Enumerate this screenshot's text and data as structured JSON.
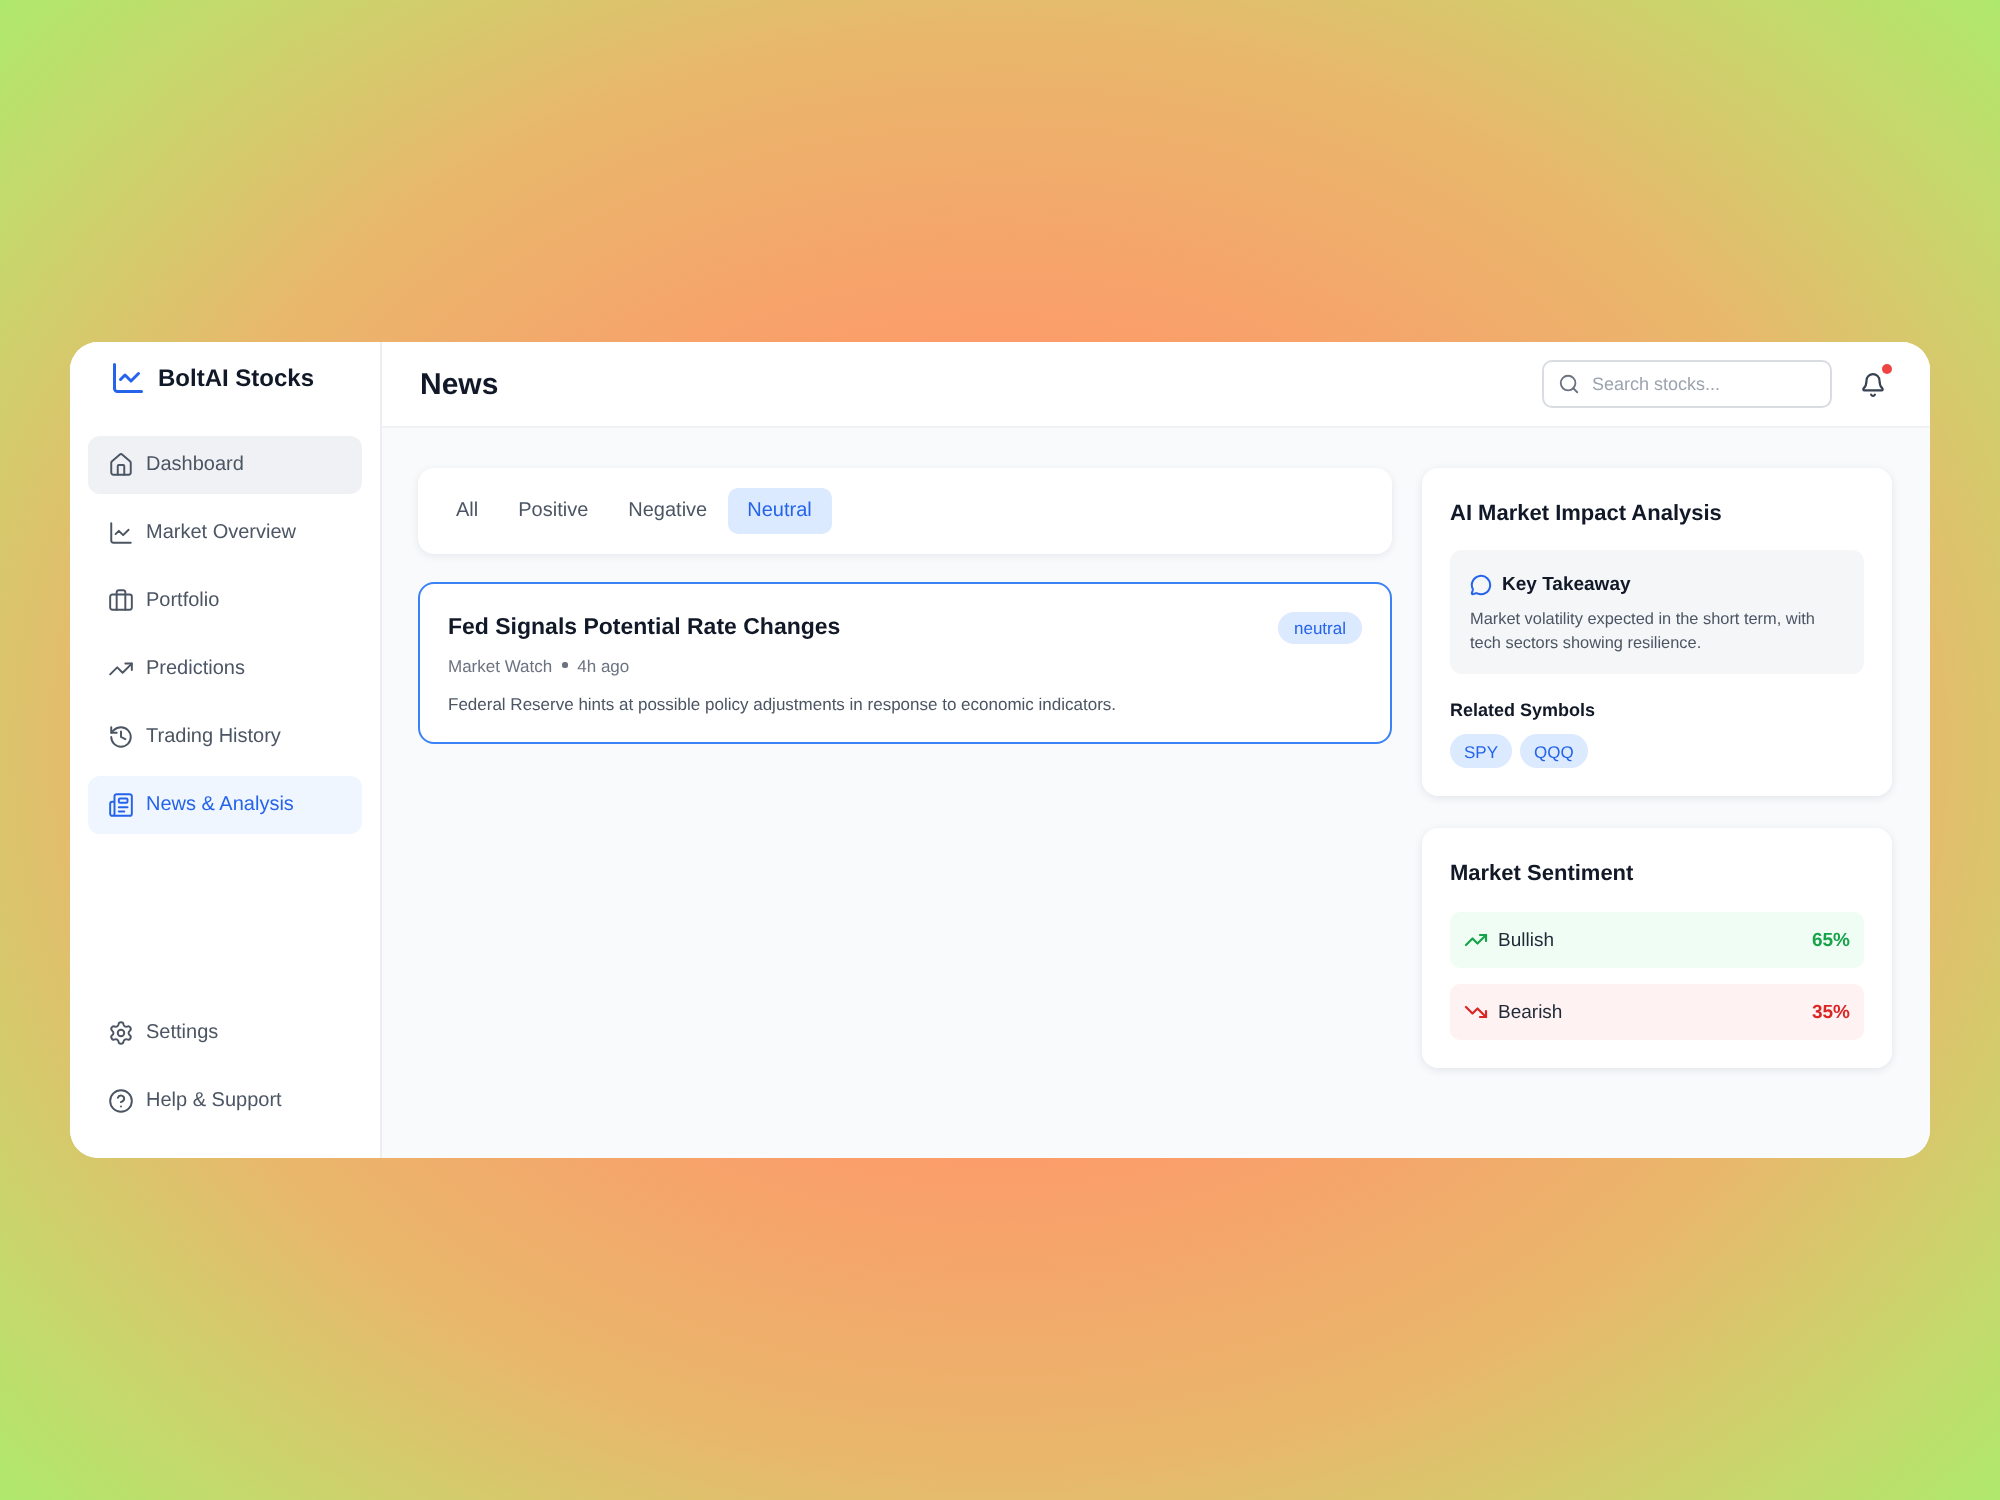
{
  "app": {
    "name": "BoltAI Stocks"
  },
  "sidebar": {
    "items": [
      {
        "label": "Dashboard",
        "selected": false,
        "hovered": true
      },
      {
        "label": "Market Overview",
        "selected": false,
        "hovered": false
      },
      {
        "label": "Portfolio",
        "selected": false,
        "hovered": false
      },
      {
        "label": "Predictions",
        "selected": false,
        "hovered": false
      },
      {
        "label": "Trading History",
        "selected": false,
        "hovered": false
      },
      {
        "label": "News & Analysis",
        "selected": true,
        "hovered": false
      }
    ],
    "footer_items": [
      {
        "label": "Settings",
        "selected": false
      },
      {
        "label": "Help & Support",
        "selected": false
      }
    ]
  },
  "header": {
    "title": "News",
    "search": {
      "placeholder": "Search stocks..."
    },
    "notifications": {
      "unread": true
    }
  },
  "filters": [
    {
      "label": "All",
      "selected": false
    },
    {
      "label": "Positive",
      "selected": false
    },
    {
      "label": "Negative",
      "selected": false
    },
    {
      "label": "Neutral",
      "selected": true
    }
  ],
  "articles": [
    {
      "title": "Fed Signals Potential Rate Changes",
      "source": "Market Watch",
      "time": "4h ago",
      "summary": "Federal Reserve hints at possible policy adjustments in response to economic indicators.",
      "sentiment": "neutral",
      "selected": true
    }
  ],
  "analysis": {
    "title": "AI Market Impact Analysis",
    "takeaway": {
      "title": "Key Takeaway",
      "text": "Market volatility expected in the short term, with tech sectors showing resilience."
    },
    "symbols_title": "Related Symbols",
    "symbols": [
      "SPY",
      "QQQ"
    ]
  },
  "sentiment": {
    "title": "Market Sentiment",
    "rows": [
      {
        "kind": "bullish",
        "label": "Bullish",
        "value": "65%"
      },
      {
        "kind": "bearish",
        "label": "Bearish",
        "value": "35%"
      }
    ]
  }
}
